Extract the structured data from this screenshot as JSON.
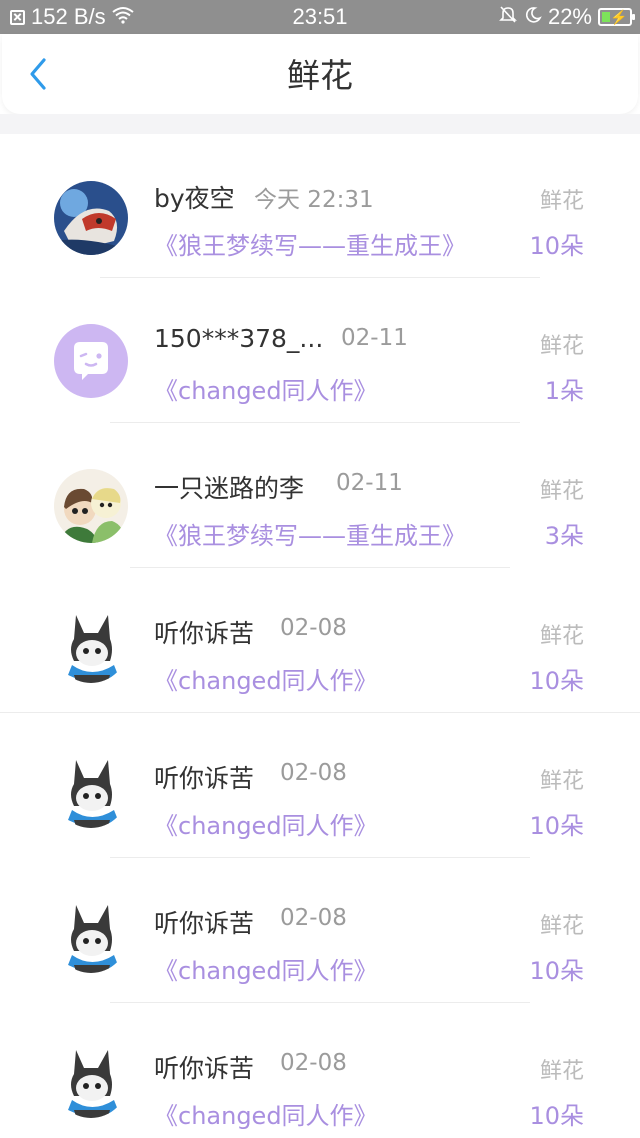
{
  "status_bar": {
    "network_speed": "152 B/s",
    "time": "23:51",
    "battery": "22%"
  },
  "header": {
    "title": "鲜花"
  },
  "items": [
    {
      "name": "by夜空",
      "time": "今天 22:31",
      "work": "《狼王梦续写——重生成王》",
      "gift_label": "鲜花",
      "gift_count": "10朵"
    },
    {
      "name": "150***378_...",
      "time": "02-11",
      "work": "《changed同人作》",
      "gift_label": "鲜花",
      "gift_count": "1朵"
    },
    {
      "name": "一只迷路的李",
      "time": "02-11",
      "work": "《狼王梦续写——重生成王》",
      "gift_label": "鲜花",
      "gift_count": "3朵"
    },
    {
      "name": "听你诉苦",
      "time": "02-08",
      "work": "《changed同人作》",
      "gift_label": "鲜花",
      "gift_count": "10朵"
    },
    {
      "name": "听你诉苦",
      "time": "02-08",
      "work": "《changed同人作》",
      "gift_label": "鲜花",
      "gift_count": "10朵"
    },
    {
      "name": "听你诉苦",
      "time": "02-08",
      "work": "《changed同人作》",
      "gift_label": "鲜花",
      "gift_count": "10朵"
    },
    {
      "name": "听你诉苦",
      "time": "02-08",
      "work": "《changed同人作》",
      "gift_label": "鲜花",
      "gift_count": "10朵"
    }
  ],
  "colors": {
    "accent_blue": "#2f9bea",
    "work_purple": "#a98fe0",
    "status_bar": "#8f8f8f"
  }
}
